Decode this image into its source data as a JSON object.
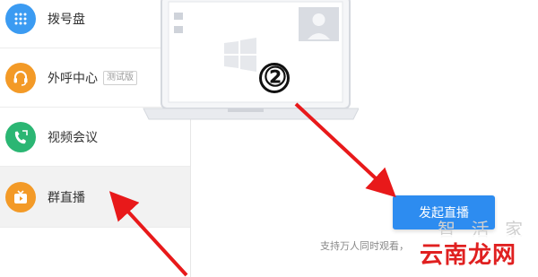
{
  "sidebar": {
    "items": [
      {
        "label": "拨号盘",
        "icon": "dialpad-icon",
        "color": "#3b9bf2"
      },
      {
        "label": "外呼中心",
        "icon": "headset-icon",
        "color": "#f39a27",
        "tag": "测试版"
      },
      {
        "label": "视频会议",
        "icon": "video-call-icon",
        "color": "#2bb673"
      },
      {
        "label": "群直播",
        "icon": "live-tv-icon",
        "color": "#f39a27",
        "active": true
      }
    ]
  },
  "main": {
    "step_marker": "②",
    "live_button": "发起直播",
    "support_text": "支持万人同时观看，",
    "accent_color": "#2d8cf0"
  },
  "watermark": {
    "text": "云南龙网",
    "faint_text": "智 活 家",
    "color": "#e02020"
  },
  "annotations": {
    "arrow_color": "#e8191a"
  }
}
